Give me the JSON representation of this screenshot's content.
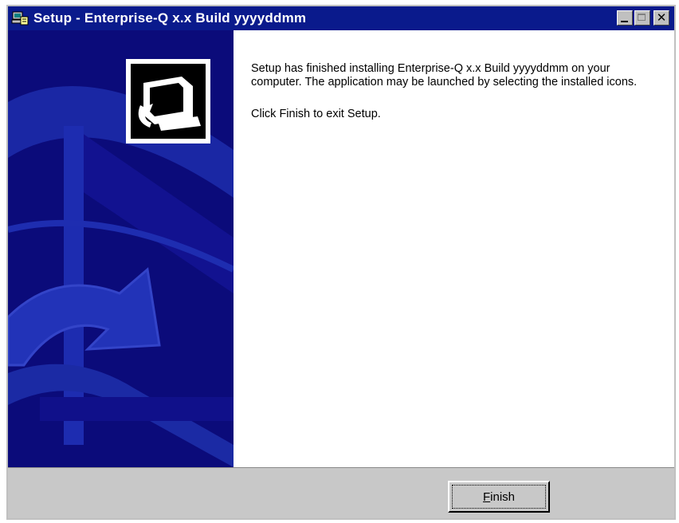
{
  "window": {
    "title": "Setup - Enterprise-Q x.x Build yyyyddmm",
    "icon": "setup-app-icon",
    "controls": {
      "minimize_icon": "minimize-icon",
      "maximize_icon": "maximize-icon",
      "close_icon": "close-icon",
      "close_glyph": "✕"
    }
  },
  "side_panel": {
    "image": "wizard-banner-image",
    "badge_icon": "computer-install-icon"
  },
  "content": {
    "message_line1": "Setup has finished installing Enterprise-Q x.x Build yyyyddmm on your computer. The application may be launched by selecting the installed icons.",
    "message_line2": "Click Finish to exit Setup."
  },
  "buttons": {
    "finish_mnemonic": "F",
    "finish_rest": "inish"
  },
  "colors": {
    "titlebar": "#0a1a8c",
    "side_panel": "#0b0b7a",
    "button_face": "#c8c8c8"
  }
}
